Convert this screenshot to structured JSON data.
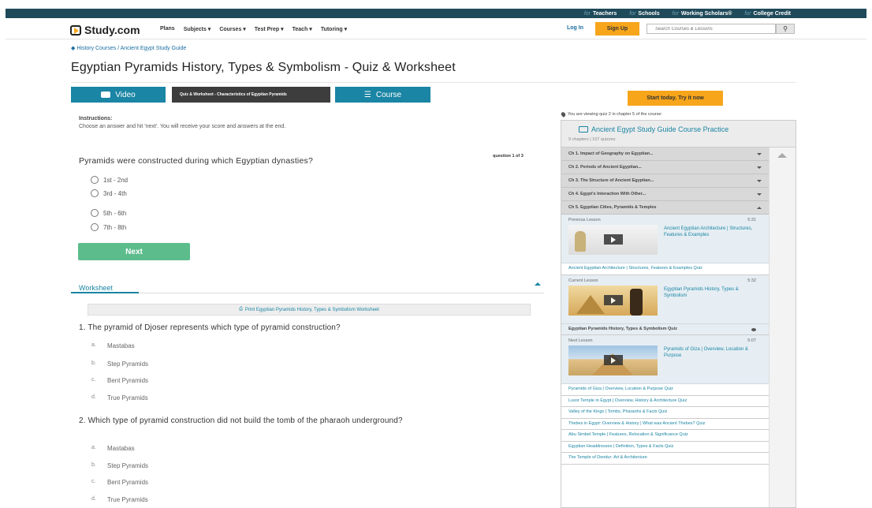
{
  "topbar": {
    "for": "for",
    "links": [
      "Teachers",
      "Schools",
      "Working Scholars®",
      "College Credit"
    ]
  },
  "nav": {
    "brand": "Study.com",
    "menu": [
      "Plans",
      "Subjects ▾",
      "Courses ▾",
      "Test Prep ▾",
      "Teach ▾",
      "Tutoring ▾"
    ],
    "login": "Log In",
    "signup": "Sign Up",
    "search_placeholder": "Search Courses & Lessons"
  },
  "breadcrumb": "◆ History Courses / Ancient Egypt Study Guide",
  "page_title": "Egyptian Pyramids History, Types & Symbolism - Quiz & Worksheet",
  "tabs": {
    "video": "Video",
    "quiz": "Quiz & Worksheet - Characteristics of Egyptian Pyramids",
    "course": "Course"
  },
  "instructions": {
    "title": "Instructions:",
    "text": "Choose an answer and hit 'next'. You will receive your score and answers at the end."
  },
  "quiz": {
    "counter": "question 1 of 3",
    "question": "Pyramids were constructed during which Egyptian dynasties?",
    "options": [
      "1st - 2nd",
      "3rd - 4th",
      "5th - 6th",
      "7th - 8th"
    ],
    "next": "Next"
  },
  "worksheet": {
    "tab": "Worksheet",
    "print": "Print Egyptian Pyramids History, Types & Symbolism Worksheet",
    "q1": "1. The pyramid of Djoser represents which type of pyramid construction?",
    "q2": "2. Which type of pyramid construction did not build the tomb of the pharaoh underground?",
    "letters": [
      "a.",
      "b.",
      "c.",
      "d."
    ],
    "options": [
      "Mastabas",
      "Step Pyramids",
      "Bent Pyramids",
      "True Pyramids"
    ]
  },
  "sidebar": {
    "cta": "Start today. Try it now",
    "viewing": "You are viewing quiz 2 in chapter 5 of the course:",
    "course_title": "Ancient Egypt Study Guide Course Practice",
    "course_meta": "9 chapters | 107 quizzes",
    "chapters": [
      "Ch 1. Impact of Geography on Egyptian...",
      "Ch 2. Periods of Ancient Egyptian...",
      "Ch 3. The Structure of Ancient Egyptian...",
      "Ch 4. Egypt's Interaction With Other...",
      "Ch 5. Egyptian Cities, Pyramids & Temples"
    ],
    "prev": {
      "label": "Previous Lesson",
      "time": "5:31",
      "title": "Ancient Egyptian Architecture | Structures, Features & Examples",
      "quiz": "Ancient Egyptian Architecture | Structures, Features & Examples Quiz"
    },
    "current": {
      "label": "Current Lesson",
      "time": "5:32",
      "title": "Egyptian Pyramids History, Types & Symbolism",
      "quiz": "Egyptian Pyramids History, Types & Symbolism Quiz"
    },
    "next": {
      "label": "Next Lesson",
      "time": "5:07",
      "title": "Pyramids of Giza | Overview, Location & Purpose",
      "quiz": "Pyramids of Giza | Overview, Location & Purpose Quiz"
    },
    "more": [
      "Luxor Temple in Egypt | Overview, History & Architecture Quiz",
      "Valley of the Kings | Tombs, Pharaohs & Facts Quiz",
      "Thebes in Egypt: Overview & History | What was Ancient Thebes? Quiz",
      "Abu Simbel Temple | Features, Relocation & Significance Quiz",
      "Egyptian Headdresses | Definition, Types & Facts Quiz",
      "The Temple of Dendur: Art & Architecture"
    ]
  }
}
